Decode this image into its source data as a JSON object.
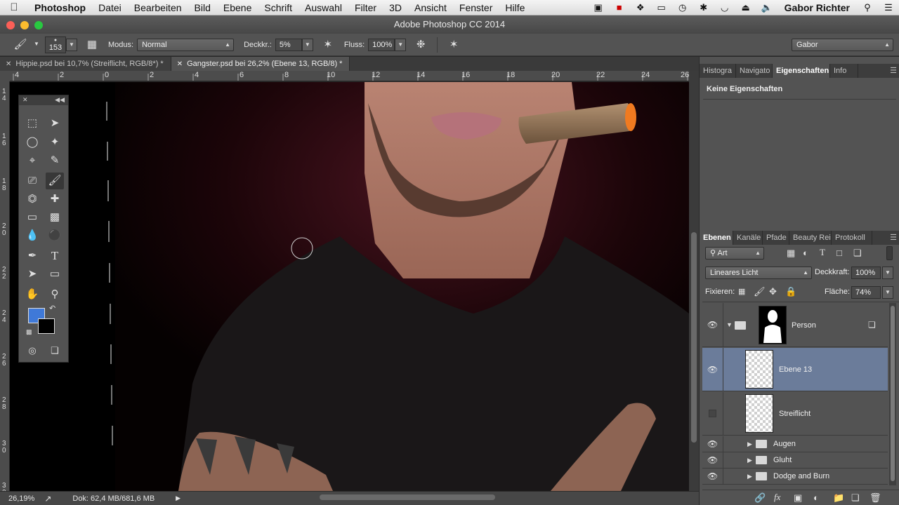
{
  "menubar": {
    "apple": "",
    "app": "Photoshop",
    "items": [
      "Datei",
      "Bearbeiten",
      "Bild",
      "Ebene",
      "Schrift",
      "Auswahl",
      "Filter",
      "3D",
      "Ansicht",
      "Fenster",
      "Hilfe"
    ],
    "user": "Gabor Richter"
  },
  "window": {
    "title": "Adobe Photoshop CC 2014"
  },
  "options": {
    "brush_size": "153",
    "mode_label": "Modus:",
    "mode_value": "Normal",
    "opacity_label": "Deckkr.:",
    "opacity_value": "5%",
    "flow_label": "Fluss:",
    "flow_value": "100%",
    "workspace": "Gabor"
  },
  "tabs": [
    {
      "label": "Hippie.psd bei 10,7% (Streiflicht, RGB/8*) *",
      "active": false
    },
    {
      "label": "Gangster.psd bei 26,2% (Ebene 13, RGB/8) *",
      "active": true
    }
  ],
  "ruler": {
    "h": [
      "4",
      "2",
      "0",
      "2",
      "4",
      "6",
      "8",
      "10",
      "12",
      "14",
      "16",
      "18",
      "20",
      "22",
      "24",
      "26"
    ],
    "v": [
      "1\n4",
      "1\n6",
      "1\n8",
      "2\n0",
      "2\n2",
      "2\n4",
      "2\n6",
      "2\n8",
      "3\n0",
      "3\n2"
    ]
  },
  "status": {
    "zoom": "26,19%",
    "doc": "Dok: 62,4 MB/681,6 MB"
  },
  "props_panel": {
    "tabs": [
      "Histogra",
      "Navigato",
      "Eigenschaften",
      "Info"
    ],
    "active": 2,
    "message": "Keine Eigenschaften"
  },
  "layers_panel": {
    "tabs": [
      "Ebenen",
      "Kanäle",
      "Pfade",
      "Beauty Rei",
      "Protokoll"
    ],
    "active": 0,
    "filter": "Art",
    "blend_mode": "Lineares Licht",
    "opacity_label": "Deckkraft:",
    "opacity_value": "100%",
    "lock_label": "Fixieren:",
    "fill_label": "Fläche:",
    "fill_value": "74%",
    "layers": [
      {
        "name": "Person",
        "type": "group-open",
        "visible": true,
        "selected": false
      },
      {
        "name": "Ebene 13",
        "type": "pixel",
        "visible": true,
        "selected": true
      },
      {
        "name": "Streiflicht",
        "type": "pixel",
        "visible": false,
        "selected": false
      },
      {
        "name": "Augen",
        "type": "group",
        "visible": true,
        "selected": false
      },
      {
        "name": "Gluht",
        "type": "group",
        "visible": true,
        "selected": false
      },
      {
        "name": "Dodge and Burn",
        "type": "group",
        "visible": true,
        "selected": false
      }
    ]
  },
  "colors": {
    "foreground": "#3f79d8",
    "background": "#000000",
    "selection": "#6b7c9a"
  }
}
